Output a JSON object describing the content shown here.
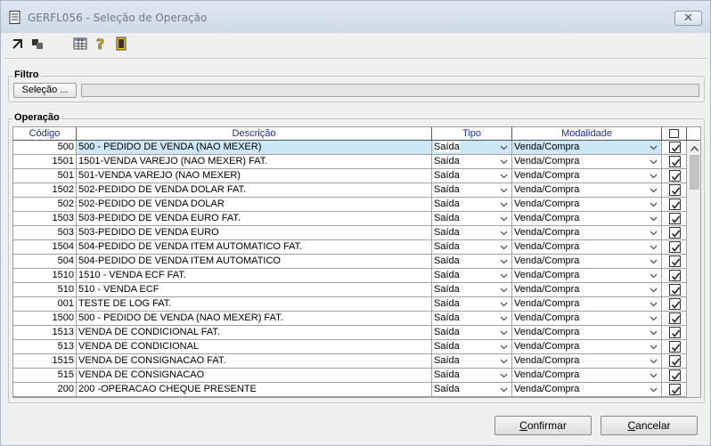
{
  "window": {
    "title": "GERFL056 - Seleção de Operação",
    "close_glyph": "✕"
  },
  "toolbar": {
    "icons": [
      "expand-icon",
      "collapse-icon",
      "grid-icon",
      "help-icon",
      "exit-icon"
    ]
  },
  "filtro": {
    "label": "Filtro",
    "button_label": "Seleção ...",
    "value": ""
  },
  "operacao": {
    "label": "Operação",
    "columns": {
      "codigo": "Código",
      "descricao": "Descrição",
      "tipo": "Tipo",
      "modalidade": "Modalidade"
    },
    "rows": [
      {
        "codigo": "500",
        "descricao": "500 - PEDIDO DE VENDA (NAO MEXER)",
        "tipo": "Saída",
        "modalidade": "Venda/Compra",
        "checked": true
      },
      {
        "codigo": "1501",
        "descricao": "1501-VENDA VAREJO (NAO MEXER) FAT.",
        "tipo": "Saída",
        "modalidade": "Venda/Compra",
        "checked": true
      },
      {
        "codigo": "501",
        "descricao": "501-VENDA VAREJO (NAO MEXER)",
        "tipo": "Saída",
        "modalidade": "Venda/Compra",
        "checked": true
      },
      {
        "codigo": "1502",
        "descricao": "502-PEDIDO DE VENDA DOLAR FAT.",
        "tipo": "Saída",
        "modalidade": "Venda/Compra",
        "checked": true
      },
      {
        "codigo": "502",
        "descricao": "502-PEDIDO DE VENDA DOLAR",
        "tipo": "Saída",
        "modalidade": "Venda/Compra",
        "checked": true
      },
      {
        "codigo": "1503",
        "descricao": "503-PEDIDO DE VENDA EURO FAT.",
        "tipo": "Saída",
        "modalidade": "Venda/Compra",
        "checked": true
      },
      {
        "codigo": "503",
        "descricao": "503-PEDIDO DE VENDA EURO",
        "tipo": "Saída",
        "modalidade": "Venda/Compra",
        "checked": true
      },
      {
        "codigo": "1504",
        "descricao": "504-PEDIDO DE VENDA ITEM AUTOMATICO FAT.",
        "tipo": "Saída",
        "modalidade": "Venda/Compra",
        "checked": true
      },
      {
        "codigo": "504",
        "descricao": "504-PEDIDO DE VENDA ITEM AUTOMATICO",
        "tipo": "Saída",
        "modalidade": "Venda/Compra",
        "checked": true
      },
      {
        "codigo": "1510",
        "descricao": "1510 - VENDA ECF FAT.",
        "tipo": "Saída",
        "modalidade": "Venda/Compra",
        "checked": true
      },
      {
        "codigo": "510",
        "descricao": "510 - VENDA ECF",
        "tipo": "Saída",
        "modalidade": "Venda/Compra",
        "checked": true
      },
      {
        "codigo": "001",
        "descricao": "TESTE DE LOG FAT.",
        "tipo": "Saída",
        "modalidade": "Venda/Compra",
        "checked": true
      },
      {
        "codigo": "1500",
        "descricao": "500 - PEDIDO DE VENDA (NAO MEXER) FAT.",
        "tipo": "Saída",
        "modalidade": "Venda/Compra",
        "checked": true
      },
      {
        "codigo": "1513",
        "descricao": "VENDA DE CONDICIONAL FAT.",
        "tipo": "Saída",
        "modalidade": "Venda/Compra",
        "checked": true
      },
      {
        "codigo": "513",
        "descricao": "VENDA DE CONDICIONAL",
        "tipo": "Saída",
        "modalidade": "Venda/Compra",
        "checked": true
      },
      {
        "codigo": "1515",
        "descricao": "VENDA DE CONSIGNACAO FAT.",
        "tipo": "Saída",
        "modalidade": "Venda/Compra",
        "checked": true
      },
      {
        "codigo": "515",
        "descricao": "VENDA DE CONSIGNACAO",
        "tipo": "Saída",
        "modalidade": "Venda/Compra",
        "checked": true
      },
      {
        "codigo": "200",
        "descricao": "200 -OPERACAO CHEQUE PRESENTE",
        "tipo": "Saída",
        "modalidade": "Venda/Compra",
        "checked": true
      }
    ]
  },
  "footer": {
    "confirm": {
      "key": "C",
      "rest": "onfirmar"
    },
    "cancel": {
      "key": "C",
      "rest": "ancelar"
    }
  }
}
